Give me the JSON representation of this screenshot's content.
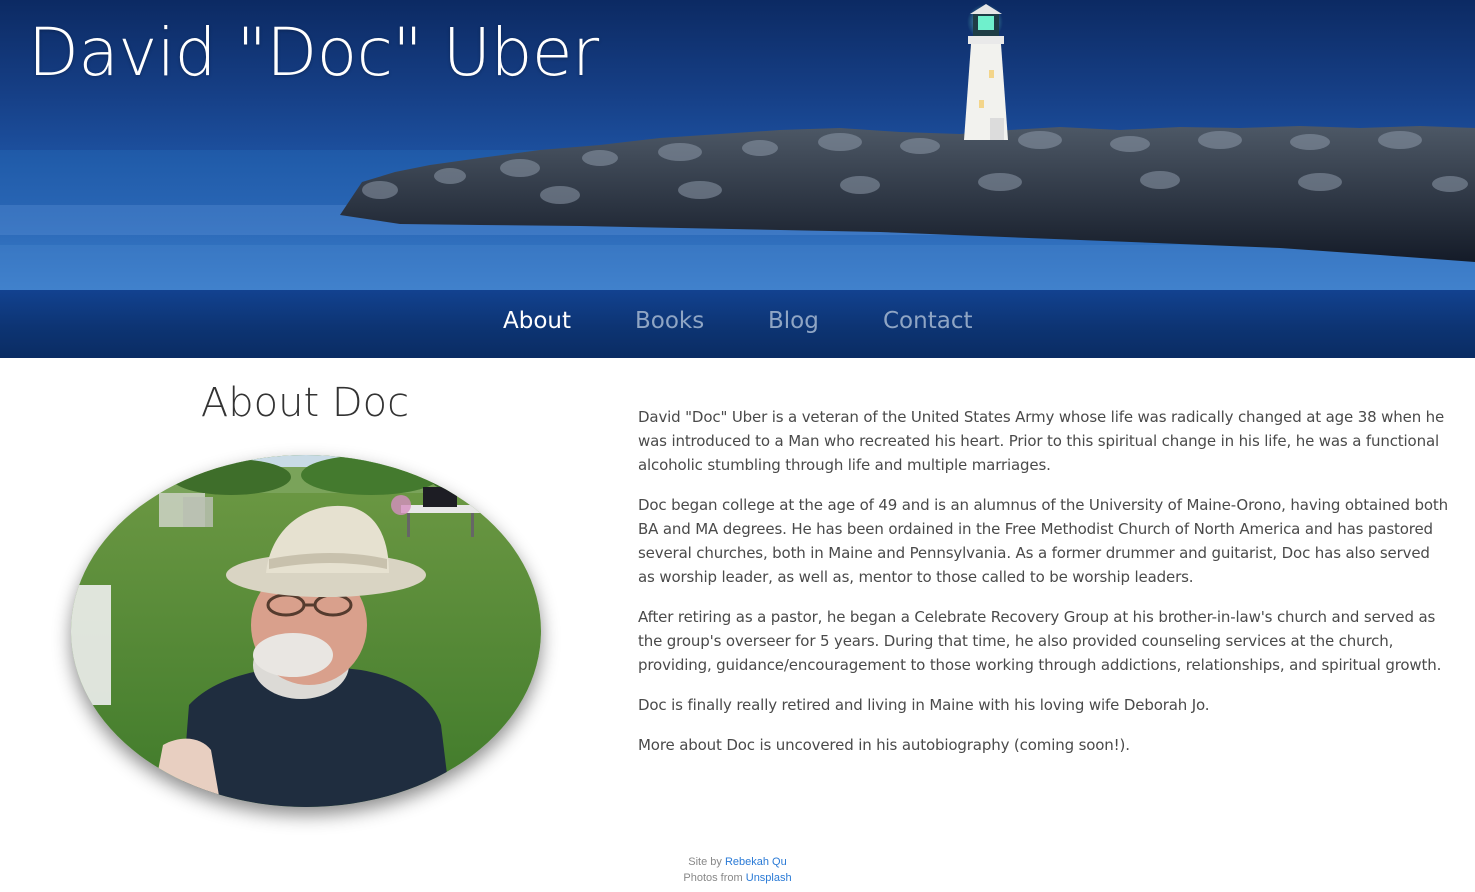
{
  "header": {
    "title": "David \"Doc\" Uber",
    "image": "lighthouse-on-rocky-jetty-at-dusk"
  },
  "nav": {
    "items": [
      {
        "label": "About",
        "active": true
      },
      {
        "label": "Books",
        "active": false
      },
      {
        "label": "Blog",
        "active": false
      },
      {
        "label": "Contact",
        "active": false
      }
    ]
  },
  "main": {
    "heading": "About Doc",
    "portrait": "photo-of-man-in-hat-on-lawn",
    "paragraphs": [
      "David \"Doc\" Uber is a veteran of the United States Army whose life was radically changed at age 38 when he was introduced to a Man who recreated his heart. Prior to this spiritual change in his life, he was a functional alcoholic stumbling through life and multiple marriages.",
      "Doc began college at the age of 49 and is an alumnus of the University of Maine-Orono, having obtained both BA and MA degrees. He has been ordained in the Free Methodist Church of North America and has pastored several churches, both in Maine and Pennsylvania. As a former drummer and guitarist, Doc has also served as worship leader, as well as, mentor to those called to be worship leaders.",
      "After retiring as a pastor, he began a Celebrate Recovery Group at his brother-in-law's church and served as the group's overseer for 5 years. During that time, he also provided counseling services at the church, providing, guidance/encouragement to those working through addictions, relationships, and spiritual growth.",
      "Doc is finally really retired and living in Maine with his loving wife Deborah Jo.",
      "More about Doc is uncovered in his autobiography (coming soon!)."
    ]
  },
  "footer": {
    "site_by_prefix": "Site by",
    "site_by_link": "Rebekah Qu",
    "photos_prefix": "Photos from",
    "photos_link": "Unsplash"
  },
  "colors": {
    "nav_bg": "#0d3473",
    "nav_active": "#ffffff",
    "nav_inactive": "#8fa5c4",
    "link": "#2a7ad6"
  }
}
